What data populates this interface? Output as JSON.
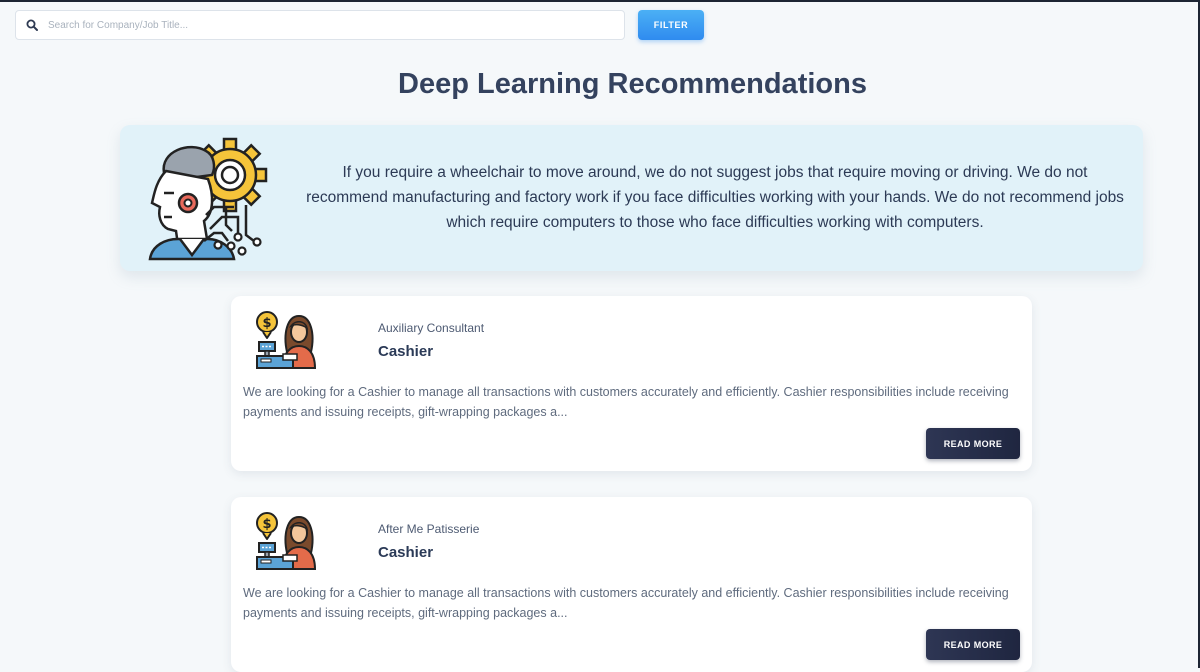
{
  "search": {
    "placeholder": "Search for Company/Job Title...",
    "value": "",
    "icon": "search-icon"
  },
  "filter": {
    "label": "FILTER",
    "color": "#3a9cf2"
  },
  "page": {
    "title": "Deep Learning Recommendations"
  },
  "info": {
    "text": "If you require a wheelchair to move around, we do not suggest jobs that require moving or driving. We do not recommend manufacturing and factory work if you face difficulties working with your hands. We do not recommend jobs which require computers to those who face difficulties working with computers.",
    "icon": "ai-head-gear-icon",
    "background": "#e1f2f9"
  },
  "jobs": [
    {
      "company": "Auxiliary Consultant",
      "title": "Cashier",
      "description": "We are looking for a Cashier to manage all transactions with customers accurately and efficiently. Cashier responsibilities include receiving payments and issuing receipts, gift-wrapping packages a...",
      "button": "READ MORE",
      "icon": "cashier-icon"
    },
    {
      "company": "After Me Patisserie",
      "title": "Cashier",
      "description": "We are looking for a Cashier to manage all transactions with customers accurately and efficiently. Cashier responsibilities include receiving payments and issuing receipts, gift-wrapping packages a...",
      "button": "READ MORE",
      "icon": "cashier-icon"
    }
  ],
  "colors": {
    "button_dark": "#262d48",
    "title": "#34425e"
  }
}
